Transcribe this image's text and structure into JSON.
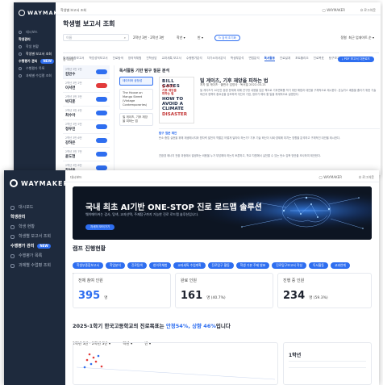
{
  "brand": "WAYMAKER",
  "win1": {
    "breadcrumb": "학생별 보고서 조회",
    "user_name": "WAYMAKER",
    "logout": "로그아웃",
    "sidebar": [
      {
        "label": "대시보드"
      },
      {
        "label": "학생관리",
        "section": true
      },
      {
        "label": "학생 현황"
      },
      {
        "label": "학생별 보고서 조회"
      },
      {
        "label": "수행평가 관리",
        "badge": "NEW"
      },
      {
        "label": "수행평가 목록"
      },
      {
        "label": "과제별 수업평 조회"
      }
    ],
    "title": "학생별 보고서 조회",
    "filters": {
      "search_placeholder": "이름",
      "year": "2학년 3반 · 2학년 3반",
      "subject": "학년",
      "class": "반",
      "search_btn": "검색 초기화"
    },
    "right_controls": {
      "sort": "정렬",
      "sort_value": "최근 업데이트 순"
    },
    "tabs": [
      "학생부종합보고서",
      "학업성적보고서",
      "진로탐색",
      "창의적체험",
      "진학상담",
      "교과세특 보고서",
      "수행평가분석",
      "자기소개서분석",
      "학생부분석",
      "면접분석",
      "독서활동",
      "진로설계",
      "포트폴리오",
      "진로목표",
      "탐구보고서"
    ],
    "active_tab_index": 10,
    "count_label": "총 10명",
    "export_btn": "PDF 보고서 다운로드",
    "students": [
      {
        "name": "김민수",
        "meta": "2학년 3반 1번"
      },
      {
        "name": "이서연",
        "meta": "2학년 3반 2번",
        "alert": true
      },
      {
        "name": "박지훈",
        "meta": "2학년 3반 3번"
      },
      {
        "name": "최수아",
        "meta": "2학년 3반 4번"
      },
      {
        "name": "정우진",
        "meta": "2학년 3반 5번"
      },
      {
        "name": "강하은",
        "meta": "2학년 3반 6번"
      },
      {
        "name": "윤도현",
        "meta": "2학년 3반 7번"
      },
      {
        "name": "장서윤",
        "meta": "2학년 3반 8번"
      }
    ],
    "doc_panel_title": "독서활동 기반 탐구 질문 분석",
    "docs": [
      "데이터와 공정성",
      "The House on Mango Street (Vintage Contemporaries)",
      "빌 게이츠, 기후 재앙을 피하는 법"
    ],
    "book": {
      "cover_line1": "BILL GATES",
      "cover_line2": "빌 게이츠,",
      "cover_line3": "기후 재앙을",
      "cover_line4": "피하는 법",
      "cover_en1": "HOW TO",
      "cover_en2": "AVOID A",
      "cover_en3": "CLIMATE",
      "cover_en4": "DISASTER",
      "title": "빌 게이츠, 기후 재앙을 피하는 법",
      "meta": "저자 빌 게이츠 · 출판사 김영사 · 독서일 2022-03-21",
      "summary": "빌 게이츠가 10년간 환경 문제에 대해 연구한 내용을 담은 책으로 기후변화를 막기 위한 해법과 대안을 구체적으로 제시한다. 온실가스 배출을 줄이기 위한 기술 혁신과 정책의 중요성을 강조하며 개인과 기업, 정부가 해야 할 일을 체계적으로 설명한다.",
      "section_label": "탐구 질문 제안",
      "question1": "탄소 중립 실현을 위해 재생에너지와 원자력 발전의 역할은 어떻게 달라야 하는가? 기후 기술 혁신이 사회·경제에 미치는 영향을 분석하고 구체적인 대안을 제시한다.",
      "question2": "친환경 에너지 전환 과정에서 발생하는 비용을 누가 부담해야 하는지 토론하고, 학교 차원에서 실천할 수 있는 탄소 감축 방안을 조사하여 제안한다."
    }
  },
  "win2": {
    "breadcrumb": "대시보드",
    "user_name": "WAYMAKER",
    "logout": "로그아웃",
    "sidebar": [
      {
        "label": "대시보드"
      },
      {
        "label": "학생관리",
        "section": true
      },
      {
        "label": "학생 현황"
      },
      {
        "label": "학생별 보고서 조회"
      },
      {
        "label": "수행평가 관리",
        "badge": "NEW"
      },
      {
        "label": "수행평가 목록"
      },
      {
        "label": "과제별 수업평 조회"
      }
    ],
    "banner": {
      "title": "국내 최초 AI기반 ONE-STOP 진로 로드맵 솔루션",
      "subtitle": "웨이메이커는 검사, 탐색, 교과선택, 주제탐구까지 가능한 진로 로드맵 솔루션입니다.",
      "cta": "자세히 보러가기"
    },
    "section_title": "캠프 진행현황",
    "chips": [
      "학생부종합보고서",
      "학업분석",
      "진로탐색",
      "창의적체험",
      "교과세특 수업계획",
      "진로탐구 활동",
      "학생 기본 주제 발표",
      "진로탐구보고서 작성",
      "독서활동",
      "교과연계"
    ],
    "selects": [
      "2학년 3반 · 2학년 3반 ▾",
      "학년 ▾",
      "반 ▾"
    ],
    "stats": [
      {
        "label": "전체 참여 인원",
        "value": "395",
        "unit": "명"
      },
      {
        "label": "완료 인원",
        "value": "161",
        "unit": "명 (40.7%)"
      },
      {
        "label": "진행 중 인원",
        "value": "234",
        "unit": "명 (59.3%)"
      }
    ],
    "goal_prefix": "2025-1학기 한국고등학교의 진로목표는 ",
    "goal_highlight": "안정54%, 상향 46%",
    "goal_suffix": "입니다",
    "goal_selects": [
      "2학년 3반 · 2학년 3반 ▾",
      "학년 ▾",
      "반 ▾"
    ],
    "grade_label": "1학년",
    "colors": {
      "accent": "#2e6ef0",
      "sidebar": "#1e2a3d",
      "danger": "#e23b3b"
    }
  }
}
